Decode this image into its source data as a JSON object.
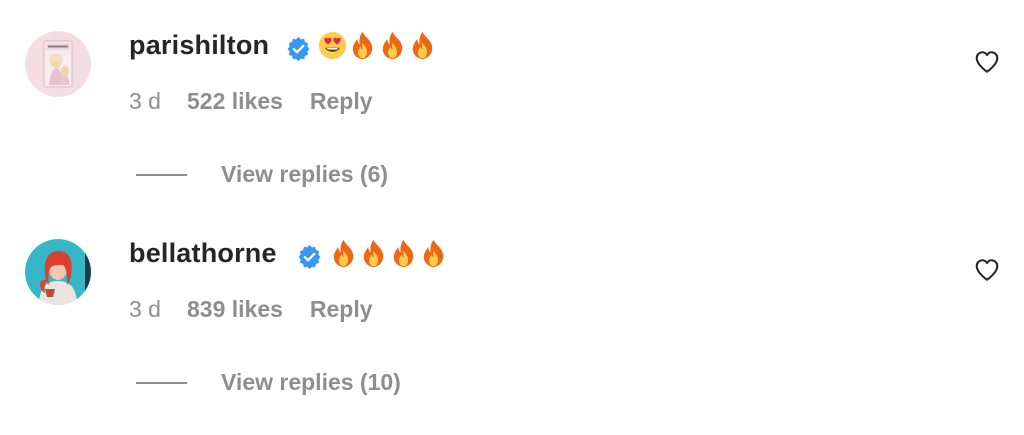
{
  "colors": {
    "text_primary": "#262626",
    "text_secondary": "#8e8e8e",
    "verified_blue": "#3897f0"
  },
  "comments": [
    {
      "username": "parishilton",
      "verified": true,
      "text_emoji": [
        "smiling-face-with-heart-eyes",
        "fire",
        "fire",
        "fire"
      ],
      "time": "3 d",
      "likes": "522 likes",
      "reply": "Reply",
      "view_replies": "View replies (6)",
      "like_icon": "heart-outline-icon"
    },
    {
      "username": "bellathorne",
      "verified": true,
      "text_emoji": [
        "fire",
        "fire",
        "fire",
        "fire"
      ],
      "time": "3 d",
      "likes": "839 likes",
      "reply": "Reply",
      "view_replies": "View replies (10)",
      "like_icon": "heart-outline-icon"
    }
  ]
}
